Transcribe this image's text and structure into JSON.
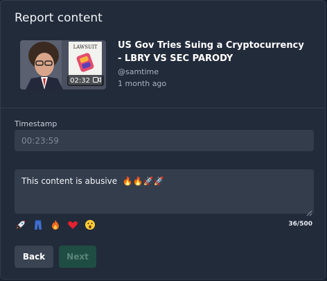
{
  "dialog": {
    "title": "Report content"
  },
  "video": {
    "thumbnail_sign_text": "LAWSUIT",
    "duration": "02:32",
    "title": "US Gov Tries Suing a Cryptocurrency - LBRY VS SEC PARODY",
    "channel": "@samtime",
    "age": "1 month ago"
  },
  "timestamp": {
    "label": "Timestamp",
    "value": "00:23:59"
  },
  "reason": {
    "value": "This content is abusive  🔥🔥🚀🚀"
  },
  "emoji_picker": [
    {
      "name": "rocket-emoji"
    },
    {
      "name": "jeans-emoji"
    },
    {
      "name": "fire-emoji"
    },
    {
      "name": "heart-emoji"
    },
    {
      "name": "astonished-face-emoji"
    }
  ],
  "char_counter": "36/500",
  "actions": {
    "back_label": "Back",
    "next_label": "Next"
  },
  "colors": {
    "next_button_bg": "#1f4d44",
    "dialog_bg": "#222b3a",
    "input_bg": "#343d4c"
  }
}
